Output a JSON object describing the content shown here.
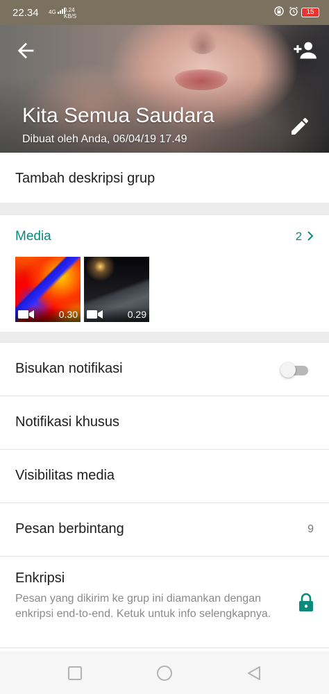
{
  "status_bar": {
    "time": "22.34",
    "network_type": "4G",
    "signal_icon": "signal-bars-icon",
    "speed_value": "0.24",
    "speed_unit": "KB/S",
    "right_icons": [
      "lock-rotation-icon",
      "alarm-icon"
    ],
    "battery_level": "15",
    "battery_color": "#e8342f"
  },
  "header": {
    "group_name": "Kita Semua Saudara",
    "created_info": "Dibuat oleh Anda, 06/04/19 17.49",
    "back_icon": "arrow-back-icon",
    "add_participant_icon": "add-person-icon",
    "edit_icon": "pencil-icon"
  },
  "description": {
    "placeholder": "Tambah deskripsi grup"
  },
  "media": {
    "label": "Media",
    "count": "2",
    "chevron_icon": "chevron-right-icon",
    "accent_color": "#0a8a7a",
    "items": [
      {
        "type_icon": "video-camera-icon",
        "duration": "0.30"
      },
      {
        "type_icon": "video-camera-icon",
        "duration": "0.29"
      }
    ]
  },
  "settings": {
    "mute": {
      "label": "Bisukan notifikasi",
      "enabled": false
    },
    "custom_notifications": {
      "label": "Notifikasi khusus"
    },
    "media_visibility": {
      "label": "Visibilitas media"
    },
    "starred_messages": {
      "label": "Pesan berbintang",
      "count": "9"
    },
    "encryption": {
      "label": "Enkripsi",
      "description": "Pesan yang dikirim ke grup ini diamankan dengan enkripsi end-to-end. Ketuk untuk info selengkapnya.",
      "icon": "lock-icon"
    }
  },
  "nav_bar": {
    "icons": [
      "recents-square-icon",
      "home-circle-icon",
      "back-triangle-icon"
    ]
  }
}
